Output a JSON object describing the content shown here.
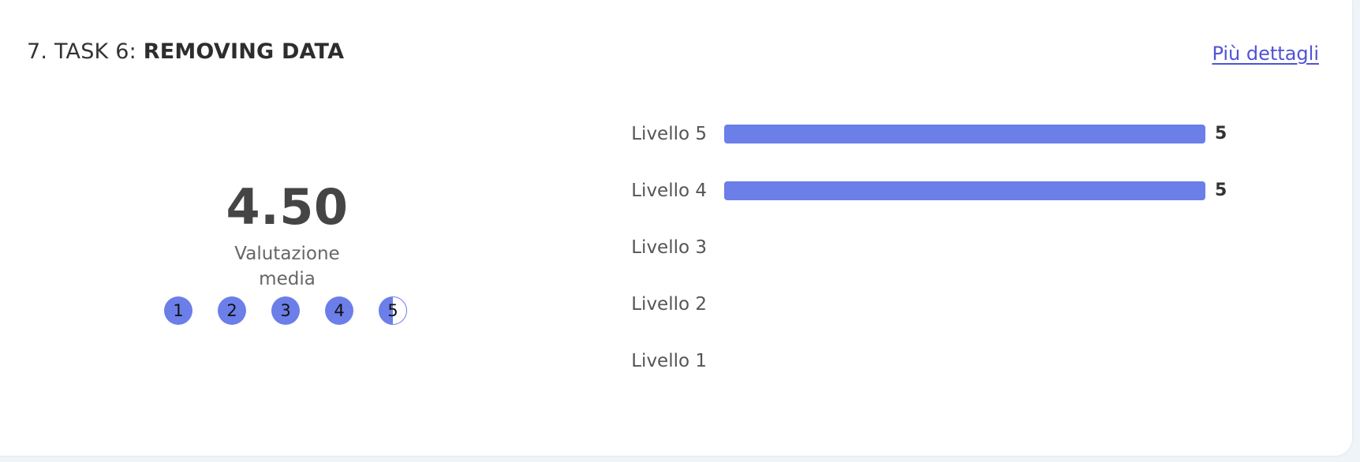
{
  "section": {
    "number_prefix": "7. TASK 6:",
    "task_name": "REMOVING DATA",
    "details_link": "Più dettagli"
  },
  "summary": {
    "average": "4.50",
    "average_value": 4.5,
    "caption_line1": "Valutazione",
    "caption_line2": "media",
    "rating_scale": [
      "1",
      "2",
      "3",
      "4",
      "5"
    ],
    "rating_fill_fraction": [
      1,
      1,
      1,
      1,
      0.5
    ]
  },
  "colors": {
    "accent": "#6c7ee8",
    "link": "#4f54d6",
    "text_dark": "#333333"
  },
  "chart_data": {
    "type": "bar",
    "orientation": "horizontal",
    "categories": [
      "Livello 5",
      "Livello 4",
      "Livello 3",
      "Livello 2",
      "Livello 1"
    ],
    "values": [
      5,
      5,
      0,
      0,
      0
    ],
    "value_labels": [
      "5",
      "5",
      "",
      "",
      ""
    ],
    "xlim": [
      0,
      5
    ],
    "grid": false
  }
}
